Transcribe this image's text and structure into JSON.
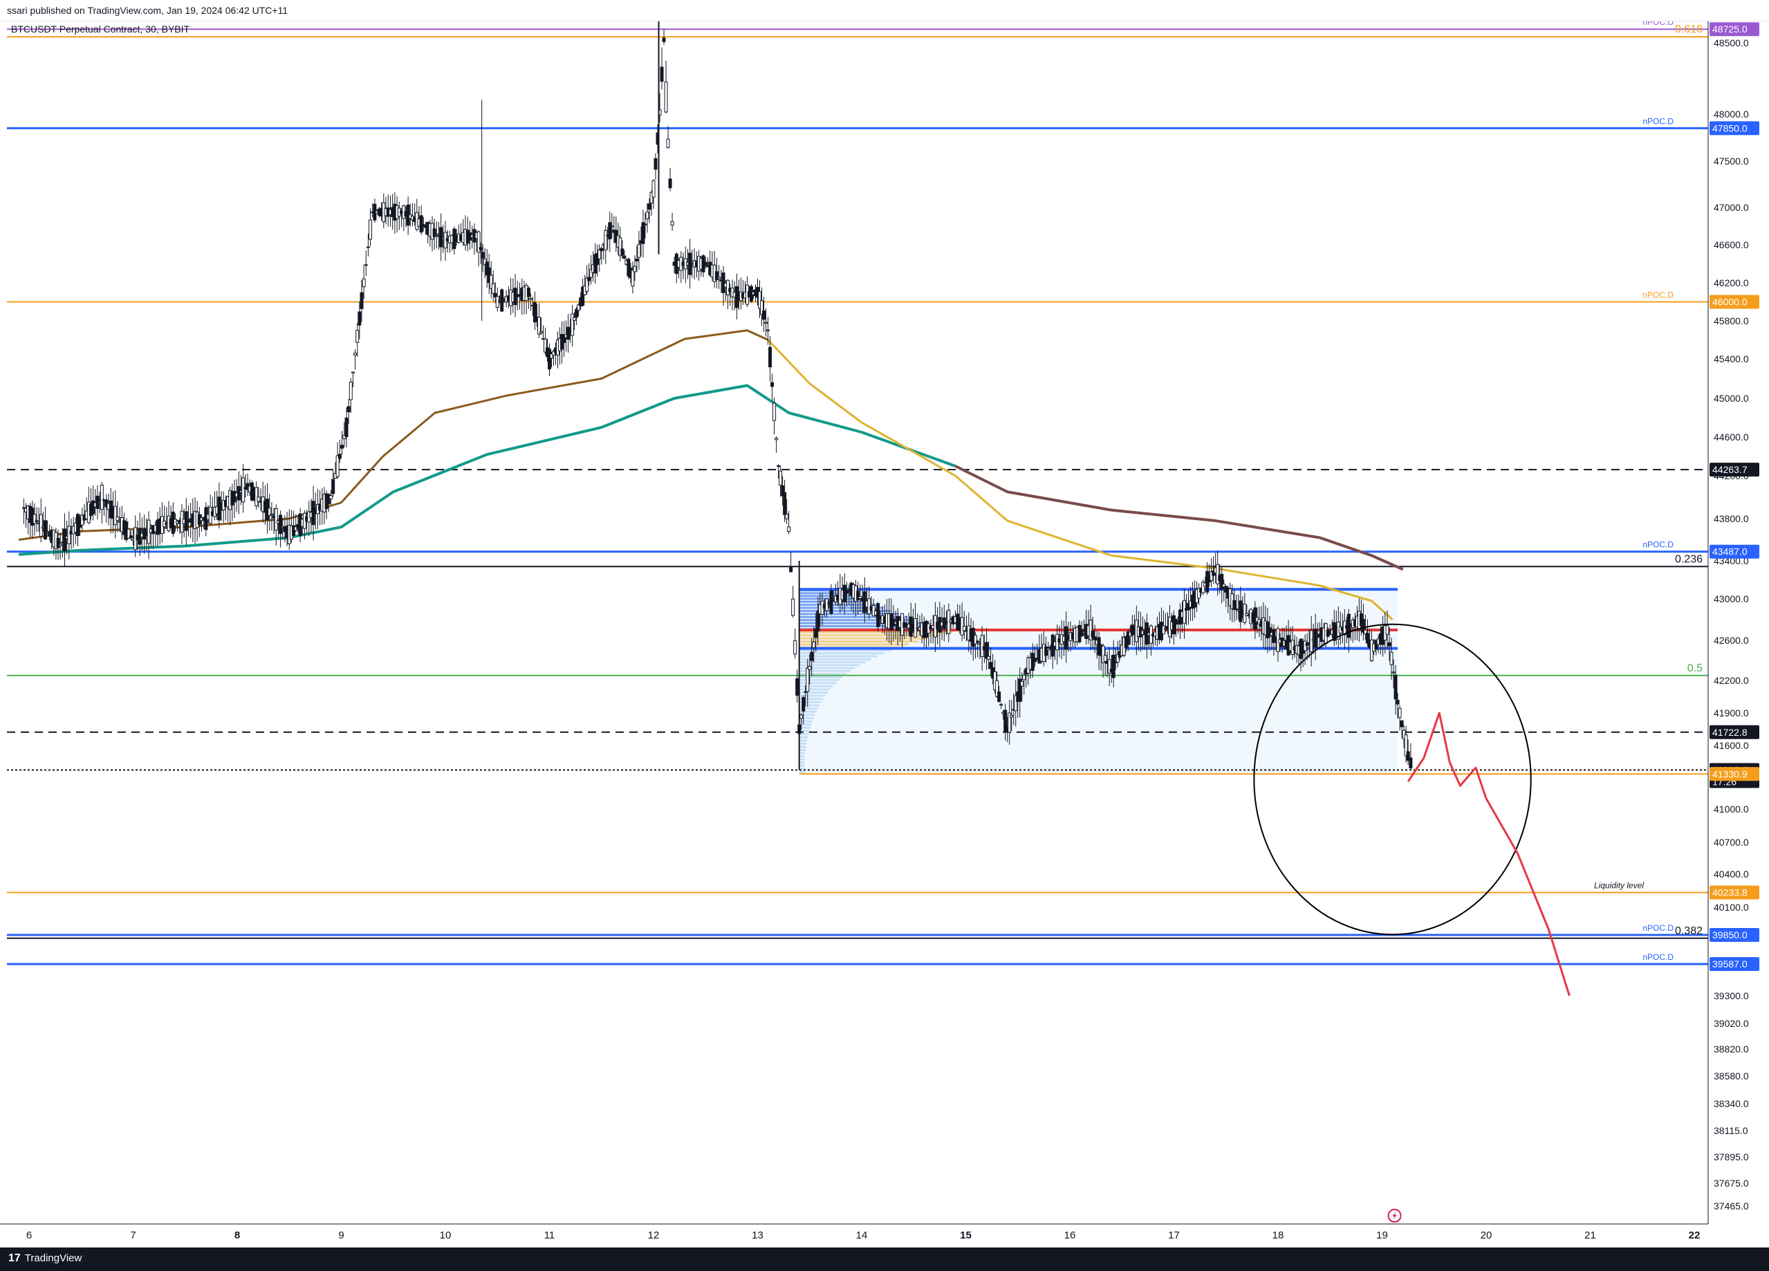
{
  "header": {
    "publisher_text": "ssari published on TradingView.com, Jan 19, 2024 06:42 UTC+11",
    "symbol_text": "BTCUSDT Perpetual Contract, 30, BYBIT"
  },
  "footer": {
    "brand": "TradingView",
    "logo_icon": "tradingview-logo-icon"
  },
  "chart_data": {
    "type": "candlestick",
    "currency": "USDT",
    "ylim": [
      37300,
      49000
    ],
    "x_axis_days": [
      "6",
      "7",
      "8",
      "9",
      "10",
      "11",
      "12",
      "13",
      "14",
      "15",
      "16",
      "17",
      "18",
      "19",
      "20",
      "21",
      "22"
    ],
    "bold_x_labels": [
      "8",
      "15",
      "22"
    ],
    "y_ticks": [
      48500,
      48000,
      47500,
      47000,
      46600,
      46200,
      45800,
      45400,
      45000,
      44600,
      44200,
      43800,
      43400,
      43000,
      42600,
      42200,
      41900,
      41600,
      41000,
      40700,
      40400,
      40100,
      39300,
      39020,
      38820,
      38580,
      38340,
      38115,
      37895,
      37675,
      37465
    ],
    "price_labels": [
      {
        "value": "48725.0",
        "price": 48725,
        "color": "#9b59d0"
      },
      {
        "value": "47850.0",
        "price": 47850,
        "color": "#2962ff"
      },
      {
        "value": "46000.0",
        "price": 46000,
        "color": "#f59d1b"
      },
      {
        "value": "44263.7",
        "price": 44263.7,
        "color": "#131722"
      },
      {
        "value": "43487.0",
        "price": 43487,
        "color": "#2962ff"
      },
      {
        "value": "41722.8",
        "price": 41722.8,
        "color": "#131722"
      },
      {
        "value": "41368.1",
        "price": 41368.1,
        "color": "#131722",
        "countdown": "17:26"
      },
      {
        "value": "41330.9",
        "price": 41330.9,
        "color": "#f59d1b"
      },
      {
        "value": "40233.8",
        "price": 40233.8,
        "color": "#f59d1b"
      },
      {
        "value": "39850.0",
        "price": 39850,
        "color": "#2962ff"
      },
      {
        "value": "39587.0",
        "price": 39587,
        "color": "#2962ff"
      }
    ],
    "horizontal_levels": [
      {
        "price": 48725,
        "color": "#9b59d0",
        "style": "solid",
        "label": "nPOC.D"
      },
      {
        "price": 48600,
        "color": "#f59d1b",
        "style": "solid",
        "label": "0.618"
      },
      {
        "price": 47850,
        "color": "#2962ff",
        "style": "solid",
        "label": "nPOC.D"
      },
      {
        "price": 46000,
        "color": "#f59d1b",
        "style": "solid",
        "label": "nPOC.D"
      },
      {
        "price": 44263.7,
        "color": "#131722",
        "style": "dashed",
        "label": ""
      },
      {
        "price": 43487,
        "color": "#2962ff",
        "style": "solid",
        "label": "nPOC.D"
      },
      {
        "price": 43340,
        "color": "#131722",
        "style": "solid",
        "label": "0.236"
      },
      {
        "price": 42250,
        "color": "#4caf50",
        "style": "solid",
        "label": "0.5"
      },
      {
        "price": 41722.8,
        "color": "#131722",
        "style": "dashed",
        "label": ""
      },
      {
        "price": 41368.1,
        "color": "#131722",
        "style": "dotted",
        "label": ""
      },
      {
        "price": 40233.8,
        "color": "#f59d1b",
        "style": "solid",
        "label": "Liquidity level"
      },
      {
        "price": 39850,
        "color": "#2962ff",
        "style": "solid",
        "label": "nPOC.D"
      },
      {
        "price": 39820,
        "color": "#131722",
        "style": "solid",
        "label": "0.382"
      },
      {
        "price": 39587,
        "color": "#2962ff",
        "style": "solid",
        "label": "nPOC.D"
      }
    ],
    "liquidity_levels": [
      "Liquidity level",
      "Liquidity level"
    ],
    "ma_green": [
      [
        5.9,
        43460
      ],
      [
        6.5,
        43500
      ],
      [
        7.5,
        43540
      ],
      [
        8.5,
        43620
      ],
      [
        9.0,
        43720
      ],
      [
        9.5,
        44050
      ],
      [
        10.4,
        44420
      ],
      [
        11.5,
        44700
      ],
      [
        12.2,
        45000
      ],
      [
        12.9,
        45130
      ],
      [
        13.3,
        44850
      ],
      [
        14.0,
        44650
      ],
      [
        14.9,
        44300
      ],
      [
        15.4,
        44050
      ],
      [
        16.4,
        43880
      ],
      [
        17.4,
        43780
      ],
      [
        18.4,
        43620
      ],
      [
        18.9,
        43450
      ],
      [
        19.2,
        43310
      ]
    ],
    "ma_gold": [
      [
        5.9,
        43600
      ],
      [
        6.5,
        43680
      ],
      [
        7.5,
        43720
      ],
      [
        8.5,
        43800
      ],
      [
        9.0,
        43950
      ],
      [
        9.4,
        44400
      ],
      [
        9.9,
        44850
      ],
      [
        10.6,
        45030
      ],
      [
        11.5,
        45200
      ],
      [
        12.3,
        45610
      ],
      [
        12.9,
        45700
      ],
      [
        13.1,
        45600
      ],
      [
        13.5,
        45150
      ],
      [
        14.0,
        44750
      ],
      [
        14.9,
        44200
      ],
      [
        15.4,
        43780
      ],
      [
        16.4,
        43450
      ],
      [
        17.4,
        43320
      ],
      [
        18.4,
        43140
      ],
      [
        18.9,
        42980
      ],
      [
        19.1,
        42800
      ]
    ],
    "candles_sampled": [
      [
        5.95,
        43900
      ],
      [
        6.3,
        43550
      ],
      [
        6.7,
        44000
      ],
      [
        7.0,
        43600
      ],
      [
        7.3,
        43750
      ],
      [
        7.7,
        43800
      ],
      [
        8.1,
        44100
      ],
      [
        8.5,
        43650
      ],
      [
        8.9,
        44000
      ],
      [
        9.05,
        44700
      ],
      [
        9.3,
        46950
      ],
      [
        9.6,
        46950
      ],
      [
        10.0,
        46650
      ],
      [
        10.3,
        46700
      ],
      [
        10.5,
        46000
      ],
      [
        10.8,
        46100
      ],
      [
        11.0,
        45400
      ],
      [
        11.2,
        45700
      ],
      [
        11.4,
        46300
      ],
      [
        11.6,
        46800
      ],
      [
        11.8,
        46250
      ],
      [
        12.0,
        47200
      ],
      [
        12.1,
        48550
      ],
      [
        12.2,
        46400
      ],
      [
        12.5,
        46400
      ],
      [
        12.8,
        46050
      ],
      [
        13.0,
        46100
      ],
      [
        13.1,
        45700
      ],
      [
        13.2,
        44300
      ],
      [
        13.3,
        43700
      ],
      [
        13.4,
        41750
      ],
      [
        13.6,
        42900
      ],
      [
        13.9,
        43100
      ],
      [
        14.2,
        42800
      ],
      [
        14.6,
        42700
      ],
      [
        14.9,
        42800
      ],
      [
        15.2,
        42500
      ],
      [
        15.4,
        41750
      ],
      [
        15.6,
        42350
      ],
      [
        15.9,
        42600
      ],
      [
        16.2,
        42700
      ],
      [
        16.4,
        42300
      ],
      [
        16.6,
        42700
      ],
      [
        16.8,
        42650
      ],
      [
        17.0,
        42750
      ],
      [
        17.2,
        43000
      ],
      [
        17.4,
        43300
      ],
      [
        17.6,
        42900
      ],
      [
        17.8,
        42800
      ],
      [
        18.0,
        42600
      ],
      [
        18.2,
        42500
      ],
      [
        18.4,
        42650
      ],
      [
        18.6,
        42700
      ],
      [
        18.8,
        42800
      ],
      [
        18.9,
        42500
      ],
      [
        19.05,
        42700
      ],
      [
        19.15,
        42000
      ],
      [
        19.25,
        41500
      ],
      [
        19.3,
        41370
      ]
    ],
    "volume_profile": {
      "x0": 13.4,
      "x1": 19.15,
      "top": 43100,
      "bottom": 41330.9,
      "vah": 43100,
      "poc": 42700,
      "val": 42520
    },
    "annotation_circle": {
      "cx": 19.1,
      "cy": 41280,
      "r_days": 1.33,
      "r_price": 1450
    },
    "projection_path": [
      [
        19.25,
        41260
      ],
      [
        19.4,
        41480
      ],
      [
        19.55,
        41900
      ],
      [
        19.65,
        41440
      ],
      [
        19.75,
        41220
      ],
      [
        19.9,
        41390
      ],
      [
        20.0,
        41100
      ],
      [
        20.3,
        40600
      ],
      [
        20.6,
        39900
      ],
      [
        20.8,
        39300
      ]
    ],
    "lightning_icon": "lightning-icon"
  }
}
